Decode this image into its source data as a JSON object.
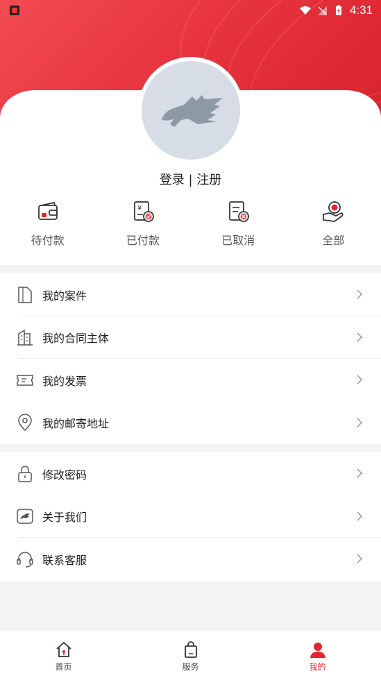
{
  "status_bar": {
    "time": "4:31"
  },
  "profile": {
    "login_text": "登录 | 注册",
    "avatar_icon": "horse-logo-icon"
  },
  "orders": [
    {
      "label": "待付款",
      "icon": "wallet-icon"
    },
    {
      "label": "已付款",
      "icon": "paid-receipt-icon"
    },
    {
      "label": "已取消",
      "icon": "cancelled-receipt-icon"
    },
    {
      "label": "全部",
      "icon": "all-orders-icon"
    }
  ],
  "menu_section_1": [
    {
      "label": "我的案件",
      "icon": "document-icon"
    },
    {
      "label": "我的合同主体",
      "icon": "building-icon"
    },
    {
      "label": "我的发票",
      "icon": "ticket-icon"
    },
    {
      "label": "我的邮寄地址",
      "icon": "location-pin-icon"
    }
  ],
  "menu_section_2": [
    {
      "label": "修改密码",
      "icon": "lock-icon"
    },
    {
      "label": "关于我们",
      "icon": "about-icon"
    },
    {
      "label": "联系客服",
      "icon": "headset-icon"
    }
  ],
  "tabbar": [
    {
      "label": "首页",
      "icon": "home-icon"
    },
    {
      "label": "服务",
      "icon": "shopping-bag-icon"
    },
    {
      "label": "我的",
      "icon": "user-icon",
      "active": true
    }
  ],
  "colors": {
    "brand_red": "#e2262f",
    "avatar_bg": "#d7dde6"
  }
}
